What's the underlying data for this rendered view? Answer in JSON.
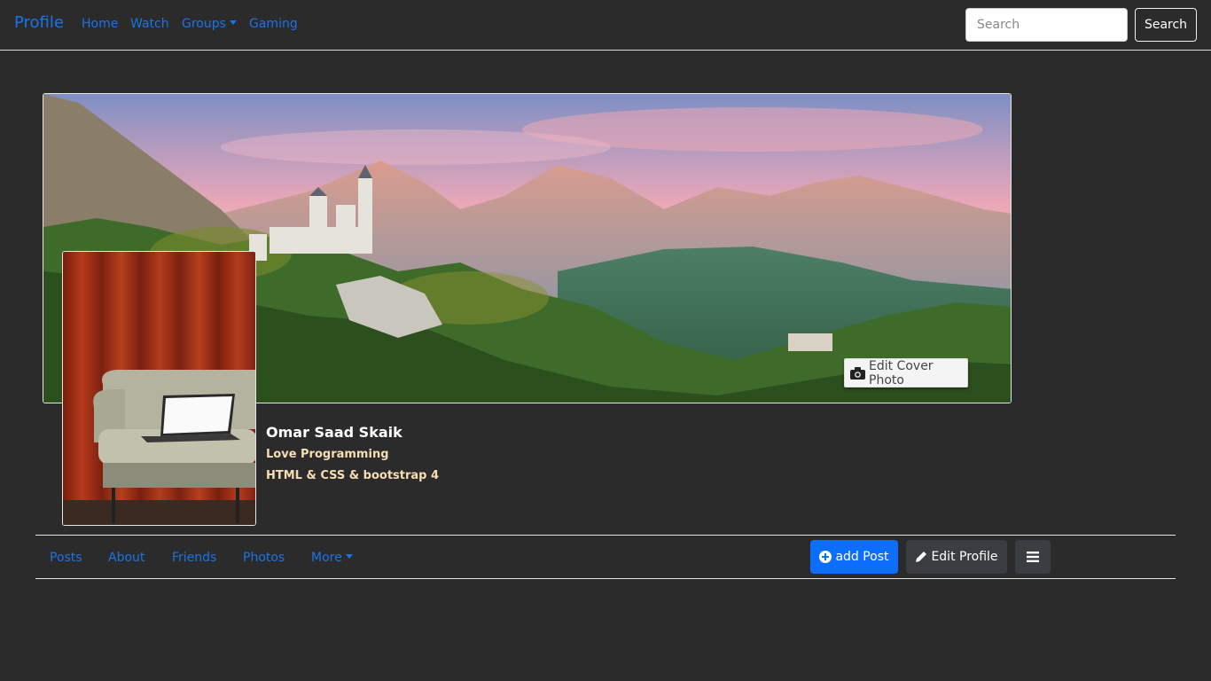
{
  "navbar": {
    "brand": "Profile",
    "links": [
      "Home",
      "Watch",
      "Groups",
      "Gaming"
    ],
    "search_placeholder": "Search",
    "search_button": "Search"
  },
  "cover": {
    "edit_label": "Edit Cover Photo"
  },
  "profile": {
    "name": "Omar Saad Skaik",
    "tagline": "Love Programming",
    "skills": "HTML & CSS & bootstrap 4"
  },
  "profile_nav": {
    "links": [
      "Posts",
      "About",
      "Friends",
      "Photos",
      "More"
    ],
    "add_post": "add Post",
    "edit_profile": "Edit Profile"
  },
  "colors": {
    "background": "#2b2b2b",
    "link": "#1a73e8",
    "primary": "#0d6efd",
    "accent_text": "#f5deb3"
  },
  "icons": [
    "caret-down-icon",
    "camera-icon",
    "plus-circle-icon",
    "pencil-icon",
    "bars-icon"
  ]
}
